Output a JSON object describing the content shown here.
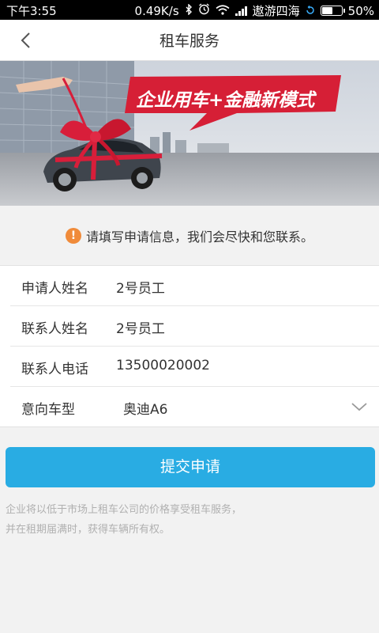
{
  "status_bar": {
    "time": "下午3:55",
    "net_speed": "0.49K/s",
    "carrier": "遨游四海",
    "battery_text": "50%",
    "battery_level": 0.5
  },
  "header": {
    "title": "租车服务"
  },
  "banner": {
    "slogan": "企业用车+金融新模式",
    "colors": {
      "ribbon": "#d81e3a",
      "slogan_bg": "#d61f36"
    }
  },
  "notice": {
    "text": "请填写申请信息，我们会尽快和您联系。"
  },
  "form": {
    "rows": [
      {
        "label": "申请人姓名",
        "value": "2号员工"
      },
      {
        "label": "联系人姓名",
        "value": "2号员工"
      },
      {
        "label": "联系人电话",
        "value": "13500020002"
      },
      {
        "label": "意向车型",
        "value": "奥迪A6"
      }
    ]
  },
  "submit": {
    "label": "提交申请",
    "color": "#29ace3"
  },
  "footnote": {
    "line1": "企业将以低于市场上租车公司的价格享受租车服务，",
    "line2": "并在租期届满时，获得车辆所有权。"
  }
}
